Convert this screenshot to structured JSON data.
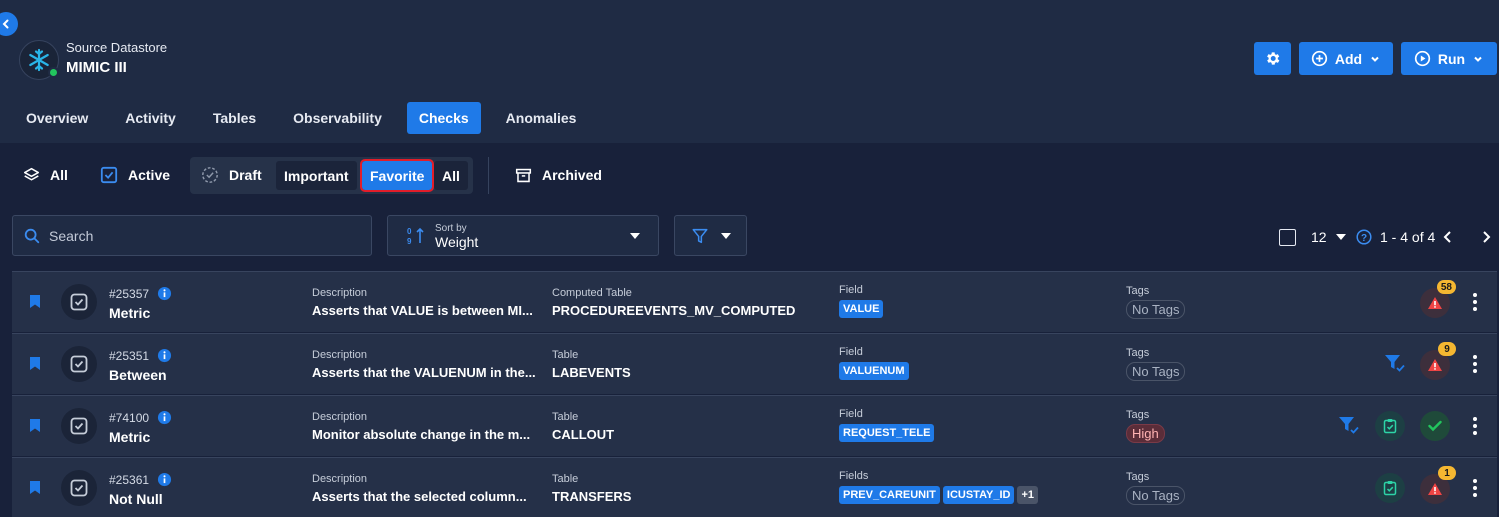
{
  "header": {
    "subtitle": "Source Datastore",
    "title": "MIMIC III",
    "add_label": "Add",
    "run_label": "Run"
  },
  "tabs": [
    "Overview",
    "Activity",
    "Tables",
    "Observability",
    "Checks",
    "Anomalies"
  ],
  "active_tab": "Checks",
  "filters": {
    "all": "All",
    "active": "Active",
    "draft": "Draft",
    "important": "Important",
    "favorite": "Favorite",
    "all2": "All",
    "archived": "Archived"
  },
  "toolbar": {
    "search_placeholder": "Search",
    "sort_label": "Sort by",
    "sort_value": "Weight",
    "page_size": "12",
    "pagination": "1 - 4 of 4"
  },
  "rows": [
    {
      "id": "#25357",
      "type": "Metric",
      "desc_label": "Description",
      "desc": "Asserts that VALUE is between MI...",
      "table_label": "Computed Table",
      "table": "PROCEDUREEVENTS_MV_COMPUTED",
      "field_label": "Field",
      "fields": [
        "VALUE"
      ],
      "tags_label": "Tags",
      "tag": "No Tags",
      "anomalies": "58"
    },
    {
      "id": "#25351",
      "type": "Between",
      "desc_label": "Description",
      "desc": "Asserts that the VALUENUM in the...",
      "table_label": "Table",
      "table": "LABEVENTS",
      "field_label": "Field",
      "fields": [
        "VALUENUM"
      ],
      "tags_label": "Tags",
      "tag": "No Tags",
      "anomalies": "9"
    },
    {
      "id": "#74100",
      "type": "Metric",
      "desc_label": "Description",
      "desc": "Monitor absolute change in the m...",
      "table_label": "Table",
      "table": "CALLOUT",
      "field_label": "Field",
      "fields": [
        "REQUEST_TELE"
      ],
      "tags_label": "Tags",
      "tag": "High"
    },
    {
      "id": "#25361",
      "type": "Not Null",
      "desc_label": "Description",
      "desc": "Asserts that the selected column...",
      "table_label": "Table",
      "table": "TRANSFERS",
      "field_label": "Fields",
      "fields": [
        "PREV_CAREUNIT",
        "ICUSTAY_ID"
      ],
      "more": "+1",
      "tags_label": "Tags",
      "tag": "No Tags",
      "anomalies": "1"
    }
  ],
  "colors": {
    "accent": "#1f7ae8",
    "bg": "#1f2b44",
    "row": "#253048",
    "warning": "#f5b731",
    "success": "#22c55e"
  }
}
